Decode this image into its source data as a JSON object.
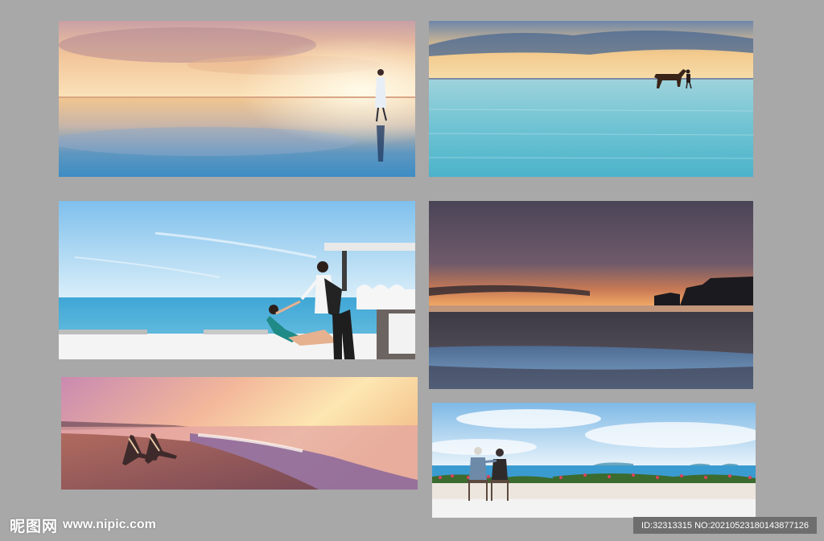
{
  "photos": [
    {
      "name": "photo-woman-sunset-reflection"
    },
    {
      "name": "photo-horse-shallow-water"
    },
    {
      "name": "photo-couple-poolside-toast"
    },
    {
      "name": "photo-dusk-beach-cliffs"
    },
    {
      "name": "photo-beach-chairs-sunset"
    },
    {
      "name": "photo-couple-seaside-terrace"
    }
  ],
  "watermark": {
    "site_cn": "昵图网",
    "site_url": "www.nipic.com",
    "id_text": "ID:32313315 NO:20210523180143877126"
  },
  "colors": {
    "background": "#a8a8a8",
    "id_bar": "#6e6e6e"
  }
}
